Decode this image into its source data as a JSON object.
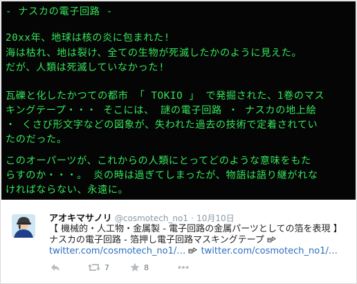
{
  "post_image": {
    "lines": [
      "- ナスカの電子回路 -",
      "20xx年、地球は核の炎に包まれた!",
      "海は枯れ、地は裂け、全ての生物が死滅したかのように見えた。",
      "だが、人類は死滅していなかった!",
      "瓦礫と化したかつての都市 「 TOKIO 」 で発掘された、1巻のマス",
      "キングテープ・・・ そこには、 謎の電子回路 ・ ナスカの地上絵",
      "・ くさび形文字などの図象が、失われた過去の技術で定着されてい",
      "たのだった。",
      "このオーパーツが、これからの人類にとってどのような意味をもた",
      "らすのか・・・。 炎の時は過ぎてしまったが、物語は語り継がれな",
      "ければならない、永遠に。"
    ],
    "text_color": "#35e65c",
    "background": "#050505"
  },
  "tweet": {
    "author_name": "アオキマサノリ",
    "handle": "@cosmotech_no1",
    "separator": "·",
    "date": "10月10日",
    "text_line1": "【 機械的・人工物・金属製 - 電子回路の金属パーツとしての箔を表現 】",
    "text_line2": "ナスカの電子回路 - 箔押し電子回路マスキングテープ",
    "text_line3_link1": "twitter.com/cosmotech_no1/…",
    "text_line3_link2": "twitter.com/cosmotech_no1/…",
    "pointing_icon": "backhand-index-pointing-right",
    "link_color": "#2a6fbf",
    "actions": {
      "reply_icon": "reply-arrow-icon",
      "retweet_icon": "retweet-icon",
      "retweet_count": "7",
      "favorite_icon": "star-icon",
      "favorite_count": "8",
      "more_icon": "more-dots-icon"
    }
  }
}
